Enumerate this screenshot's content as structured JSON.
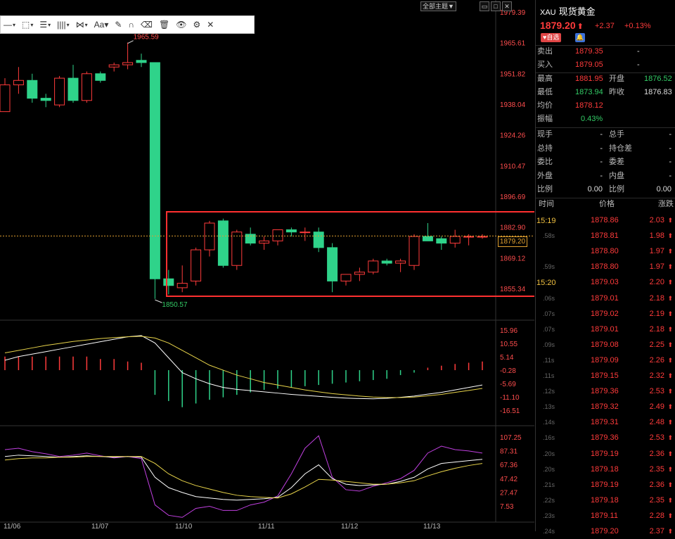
{
  "toolbar": {
    "items": [
      "▾",
      "▾",
      "▾",
      "▾",
      "▾",
      "Aa▾"
    ],
    "main_selector": "全部主题▼"
  },
  "colors": {
    "up": "#ff3b3b",
    "down": "#2fd38a",
    "box": "#ff3030",
    "dif": "#ffffff",
    "dea": "#e8d44a",
    "k": "#ffffff",
    "d": "#e8d44a",
    "j": "#c040e0"
  },
  "chart_data": [
    {
      "type": "candlestick",
      "title": "",
      "y_labels": [
        "1979.39",
        "1965.61",
        "1951.82",
        "1938.04",
        "1924.26",
        "1910.47",
        "1896.69",
        "1882.90",
        "1869.12",
        "1855.34"
      ],
      "ylim": [
        1848,
        1985
      ],
      "x_labels": [
        "11/06",
        "11/07",
        "11/10",
        "11/11",
        "11/12",
        "11/13"
      ],
      "high_annotation": "1965.59",
      "low_annotation": "1850.57",
      "current_price": "1879.20",
      "candles": [
        {
          "o": 1935,
          "h": 1950,
          "l": 1935,
          "c": 1947
        },
        {
          "o": 1947,
          "h": 1955,
          "l": 1943,
          "c": 1949
        },
        {
          "o": 1949,
          "h": 1952,
          "l": 1939,
          "c": 1941
        },
        {
          "o": 1941,
          "h": 1943,
          "l": 1937,
          "c": 1940
        },
        {
          "o": 1938,
          "h": 1951,
          "l": 1937,
          "c": 1950
        },
        {
          "o": 1950,
          "h": 1956,
          "l": 1939,
          "c": 1940
        },
        {
          "o": 1940,
          "h": 1953,
          "l": 1939,
          "c": 1952
        },
        {
          "o": 1952,
          "h": 1953,
          "l": 1948,
          "c": 1949
        },
        {
          "o": 1955,
          "h": 1957,
          "l": 1953,
          "c": 1956
        },
        {
          "o": 1956,
          "h": 1966,
          "l": 1954,
          "c": 1957
        },
        {
          "o": 1958,
          "h": 1961,
          "l": 1955,
          "c": 1957
        },
        {
          "o": 1957,
          "h": 1957,
          "l": 1851,
          "c": 1860
        },
        {
          "o": 1860,
          "h": 1864,
          "l": 1853,
          "c": 1857
        },
        {
          "o": 1856,
          "h": 1866,
          "l": 1854,
          "c": 1858
        },
        {
          "o": 1859,
          "h": 1874,
          "l": 1857,
          "c": 1873
        },
        {
          "o": 1873,
          "h": 1886,
          "l": 1870,
          "c": 1885
        },
        {
          "o": 1886,
          "h": 1887,
          "l": 1865,
          "c": 1866
        },
        {
          "o": 1866,
          "h": 1882,
          "l": 1864,
          "c": 1881
        },
        {
          "o": 1880,
          "h": 1883,
          "l": 1875,
          "c": 1876
        },
        {
          "o": 1876,
          "h": 1879,
          "l": 1873,
          "c": 1877
        },
        {
          "o": 1877,
          "h": 1882,
          "l": 1875,
          "c": 1882
        },
        {
          "o": 1882,
          "h": 1883,
          "l": 1879,
          "c": 1881
        },
        {
          "o": 1881,
          "h": 1883,
          "l": 1877,
          "c": 1881
        },
        {
          "o": 1881,
          "h": 1883,
          "l": 1872,
          "c": 1874
        },
        {
          "o": 1874,
          "h": 1876,
          "l": 1854,
          "c": 1859
        },
        {
          "o": 1859,
          "h": 1862,
          "l": 1857,
          "c": 1862
        },
        {
          "o": 1862,
          "h": 1865,
          "l": 1859,
          "c": 1863
        },
        {
          "o": 1863,
          "h": 1869,
          "l": 1862,
          "c": 1868
        },
        {
          "o": 1868,
          "h": 1869,
          "l": 1866,
          "c": 1867
        },
        {
          "o": 1867,
          "h": 1869,
          "l": 1863,
          "c": 1868
        },
        {
          "o": 1866,
          "h": 1880,
          "l": 1864,
          "c": 1879
        },
        {
          "o": 1879,
          "h": 1885,
          "l": 1877,
          "c": 1877
        },
        {
          "o": 1878,
          "h": 1879,
          "l": 1873,
          "c": 1876
        },
        {
          "o": 1876,
          "h": 1882,
          "l": 1874,
          "c": 1879
        },
        {
          "o": 1879,
          "h": 1880,
          "l": 1875,
          "c": 1879
        },
        {
          "o": 1879,
          "h": 1880,
          "l": 1878,
          "c": 1879
        }
      ]
    },
    {
      "type": "line",
      "indicator": "MACD",
      "y_labels": [
        "15.96",
        "10.55",
        "5.14",
        "-0.28",
        "-5.69",
        "-11.10",
        "-16.51"
      ],
      "ylim": [
        -18,
        17
      ],
      "histogram": [
        5.5,
        5.5,
        5.5,
        5.5,
        5.5,
        5.5,
        5.5,
        4.5,
        4.5,
        3.5,
        3,
        -10,
        -12.5,
        -15,
        -13.5,
        -12,
        -11,
        -10,
        -9,
        -8,
        -7.5,
        -7,
        -6.5,
        -6,
        -5.5,
        -5,
        -4.5,
        -4,
        -3.5,
        -2,
        -1,
        1,
        1.8,
        2.5,
        3,
        3.5
      ],
      "dif": [
        4,
        5.5,
        6.5,
        7.5,
        8.5,
        9.5,
        10.5,
        11.5,
        12.5,
        13.5,
        14,
        11,
        5,
        -1,
        -3.5,
        -5.5,
        -7,
        -7.8,
        -8.3,
        -8.8,
        -9.3,
        -9.8,
        -10.2,
        -10.6,
        -11,
        -11.3,
        -11.5,
        -11.6,
        -11.4,
        -11,
        -10.5,
        -9.7,
        -9,
        -8,
        -7,
        -6
      ],
      "dea": [
        7,
        8,
        9,
        10,
        10.8,
        11.6,
        12.2,
        12.8,
        13.2,
        13.5,
        13.7,
        13,
        11,
        8,
        5,
        2,
        0,
        -2,
        -3.5,
        -5,
        -6,
        -7,
        -8,
        -8.8,
        -9.5,
        -10,
        -10.5,
        -10.9,
        -11.1,
        -11.1,
        -10.9,
        -10.4,
        -9.8,
        -9,
        -8.2,
        -7.4
      ]
    },
    {
      "type": "line",
      "indicator": "KDJ",
      "y_labels": [
        "107.25",
        "87.31",
        "67.36",
        "47.42",
        "27.47",
        "7.53"
      ],
      "ylim": [
        0,
        112
      ],
      "k": [
        80,
        82,
        81,
        80,
        79,
        80,
        81,
        80,
        79,
        80,
        79,
        50,
        35,
        28,
        22,
        20,
        18,
        17,
        18,
        19,
        21,
        35,
        55,
        68,
        48,
        40,
        38,
        39,
        40,
        44,
        50,
        62,
        70,
        72,
        74,
        76
      ],
      "d": [
        75,
        77,
        78,
        78,
        79,
        79,
        80,
        80,
        80,
        80,
        80,
        70,
        55,
        45,
        38,
        33,
        28,
        24,
        22,
        21,
        20,
        26,
        36,
        47,
        46,
        44,
        42,
        40,
        40,
        42,
        45,
        52,
        58,
        63,
        67,
        70
      ],
      "j": [
        90,
        92,
        87,
        84,
        80,
        82,
        85,
        81,
        78,
        80,
        77,
        10,
        -5,
        -8,
        5,
        8,
        2,
        2,
        10,
        14,
        23,
        55,
        92,
        110,
        50,
        32,
        30,
        37,
        42,
        48,
        60,
        85,
        95,
        90,
        88,
        85
      ]
    }
  ],
  "quote": {
    "code": "XAU",
    "name": "现货黄金",
    "price": "1879.20",
    "price_arrow": "⬆",
    "change": "+2.37",
    "change_pct": "+0.13%",
    "badge": "自选",
    "sell_label": "卖出",
    "sell_value": "1879.35",
    "sell_vol": "-",
    "buy_label": "买入",
    "buy_value": "1879.05",
    "buy_vol": "-",
    "high_label": "最高",
    "high_value": "1881.95",
    "open_label": "开盘",
    "open_value": "1876.52",
    "low_label": "最低",
    "low_value": "1873.94",
    "prev_label": "昨收",
    "prev_value": "1876.83",
    "avg_label": "均价",
    "avg_value": "1878.12",
    "amp_label": "振幅",
    "amp_value": "0.43%",
    "stats": [
      {
        "l1": "现手",
        "v1": "-",
        "l2": "总手",
        "v2": "-"
      },
      {
        "l1": "总持",
        "v1": "-",
        "l2": "持仓差",
        "v2": "-"
      },
      {
        "l1": "委比",
        "v1": "-",
        "l2": "委差",
        "v2": "-"
      },
      {
        "l1": "外盘",
        "v1": "-",
        "l2": "内盘",
        "v2": "-"
      },
      {
        "l1": "比例",
        "v1": "0.00",
        "l2": "比例",
        "v2": "0.00"
      }
    ],
    "tick_headers": [
      "时间",
      "价格",
      "涨跌"
    ],
    "time_marks": [
      "15:19",
      "15:20"
    ],
    "ticks": [
      {
        "t": "",
        "p": "1878.86",
        "c": "2.03"
      },
      {
        "t": ".58s",
        "p": "1878.81",
        "c": "1.98"
      },
      {
        "t": "",
        "p": "1878.80",
        "c": "1.97"
      },
      {
        "t": ".59s",
        "p": "1878.80",
        "c": "1.97"
      },
      {
        "t": "",
        "p": "1879.03",
        "c": "2.20"
      },
      {
        "t": ".06s",
        "p": "1879.01",
        "c": "2.18"
      },
      {
        "t": ".07s",
        "p": "1879.02",
        "c": "2.19"
      },
      {
        "t": ".07s",
        "p": "1879.01",
        "c": "2.18"
      },
      {
        "t": ".09s",
        "p": "1879.08",
        "c": "2.25"
      },
      {
        "t": ".11s",
        "p": "1879.09",
        "c": "2.26"
      },
      {
        "t": ".11s",
        "p": "1879.15",
        "c": "2.32"
      },
      {
        "t": ".12s",
        "p": "1879.36",
        "c": "2.53"
      },
      {
        "t": ".13s",
        "p": "1879.32",
        "c": "2.49"
      },
      {
        "t": ".14s",
        "p": "1879.31",
        "c": "2.48"
      },
      {
        "t": ".16s",
        "p": "1879.36",
        "c": "2.53"
      },
      {
        "t": ".20s",
        "p": "1879.19",
        "c": "2.36"
      },
      {
        "t": ".20s",
        "p": "1879.18",
        "c": "2.35"
      },
      {
        "t": ".21s",
        "p": "1879.19",
        "c": "2.36"
      },
      {
        "t": ".22s",
        "p": "1879.18",
        "c": "2.35"
      },
      {
        "t": ".23s",
        "p": "1879.11",
        "c": "2.28"
      },
      {
        "t": ".24s",
        "p": "1879.20",
        "c": "2.37"
      }
    ]
  }
}
